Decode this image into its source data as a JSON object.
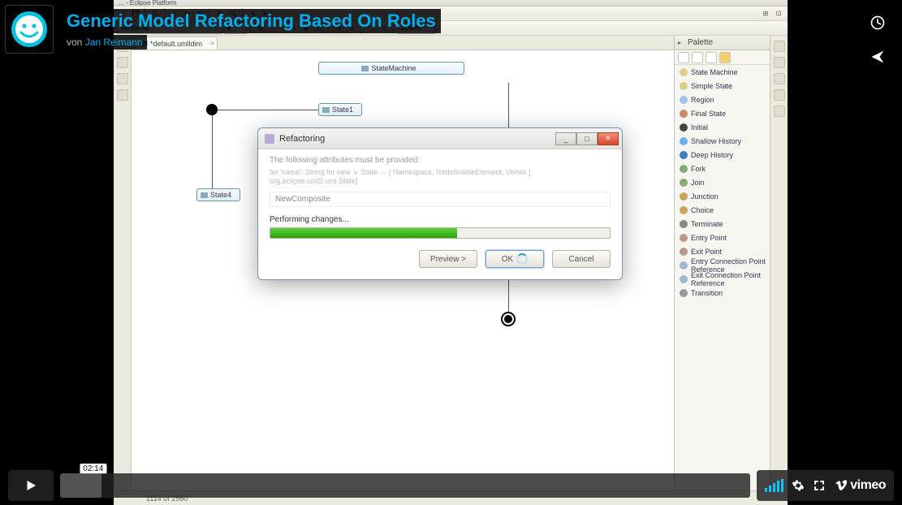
{
  "video": {
    "title": "Generic Model Refactoring Based On Roles",
    "by_prefix": "von ",
    "author": "Jan Reimann",
    "current_time": "02:14",
    "logo": "vimeo"
  },
  "eclipse": {
    "window_title_fragment": "... - Eclipse Platform",
    "font_family": "Tahoma",
    "font_size": "9",
    "zoom": "100%",
    "editor_tab": "*default.umlldim",
    "status_text": "1114 of 2560"
  },
  "canvas": {
    "container_label": "StateMachine",
    "state1": "State1",
    "state4": "State4"
  },
  "palette": {
    "title": "Palette",
    "items": [
      "State Machine",
      "Simple State",
      "Region",
      "Final State",
      "Initial",
      "Shallow History",
      "Deep History",
      "Fork",
      "Join",
      "Junction",
      "Choice",
      "Terminate",
      "Entry Point",
      "Exit Point",
      "Entry Connection Point Reference",
      "Exit Connection Point Reference",
      "Transition"
    ],
    "icon_colors": [
      "#d9cf8a",
      "#d9cf8a",
      "#9ec4e8",
      "#c86",
      "#444",
      "#6bb0e8",
      "#3a7ec2",
      "#8a7",
      "#8a7",
      "#caa35b",
      "#caa35b",
      "#888",
      "#b98",
      "#b98",
      "#a0b8ce",
      "#a0b8ce",
      "#999"
    ]
  },
  "dialog": {
    "title": "Refactoring",
    "hint": "The following attributes must be provided:",
    "hint2": "for 'name': String for new  ↳  State → [ Namespace, RedefinableElement, Vertex ] org.eclipse.uml2.uml.State]",
    "field_value": "NewComposite",
    "progress_label": "Performing changes...",
    "buttons": {
      "preview": "Preview >",
      "ok": "OK",
      "cancel": "Cancel"
    },
    "progress_pct": 55
  }
}
